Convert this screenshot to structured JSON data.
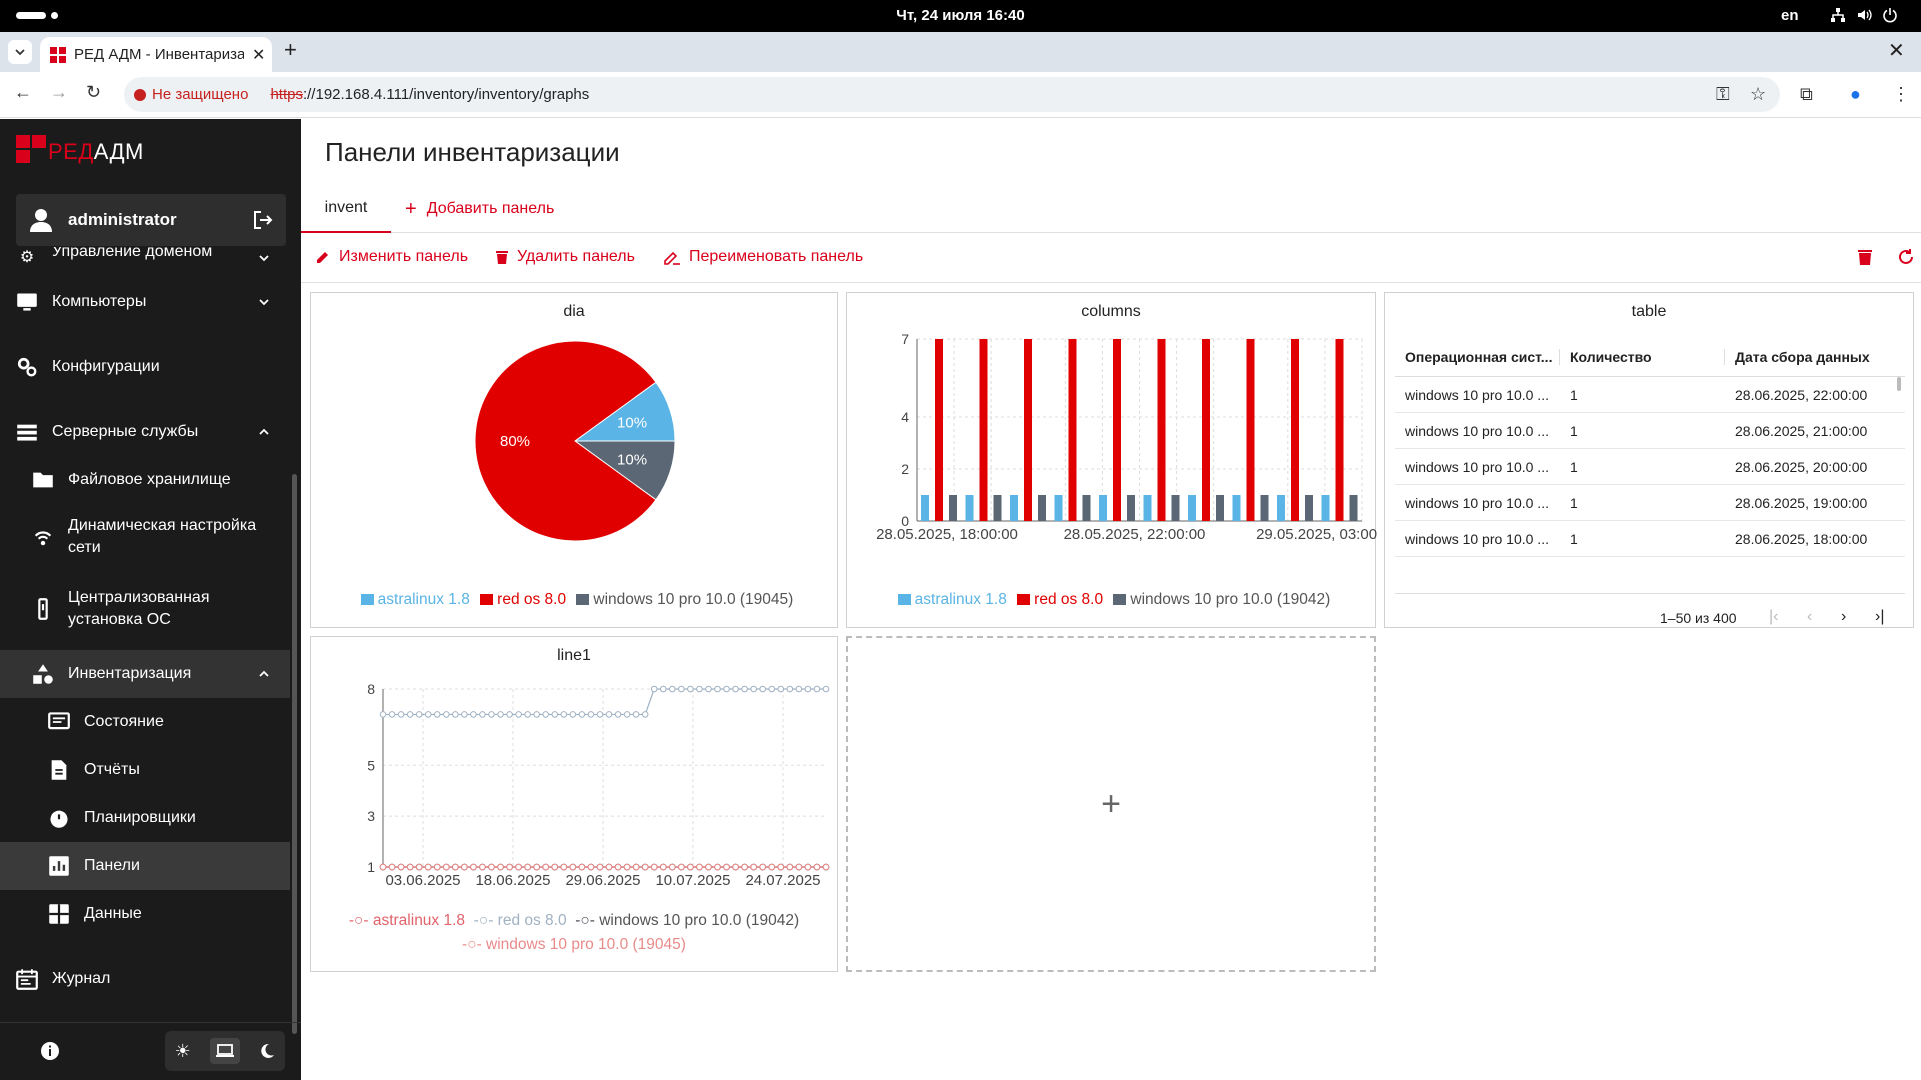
{
  "system": {
    "clock": "Чт, 24 июля  16:40",
    "lang": "en"
  },
  "browser": {
    "tab_title": "РЕД АДМ - Инвентаризация",
    "security_warning": "Не защищено",
    "url_scheme": "https",
    "url_rest": "://192.168.4.111/inventory/inventory/graphs"
  },
  "sidebar": {
    "logo_red": "РЕД",
    "logo_white": "АДМ",
    "user": "administrator",
    "items": [
      {
        "label": "Управление доменом"
      },
      {
        "label": "Компьютеры"
      },
      {
        "label": "Конфигурации"
      },
      {
        "label": "Серверные службы"
      },
      {
        "label": "Файловое хранилище"
      },
      {
        "label": "Динамическая настройка сети"
      },
      {
        "label": "Централизованная установка ОС"
      },
      {
        "label": "Инвентаризация"
      },
      {
        "label": "Состояние"
      },
      {
        "label": "Отчёты"
      },
      {
        "label": "Планировщики"
      },
      {
        "label": "Панели"
      },
      {
        "label": "Данные"
      },
      {
        "label": "Журнал"
      }
    ]
  },
  "main": {
    "title": "Панели инвентаризации",
    "tabs": [
      {
        "label": "invent"
      },
      {
        "label": "Добавить панель"
      }
    ],
    "actions": {
      "edit": "Изменить панель",
      "delete": "Удалить панель",
      "rename": "Переименовать панель"
    }
  },
  "colors": {
    "astralinux": "#5ab4e5",
    "redos": "#e00000",
    "windows": "#5b6775",
    "accent": "#d9001b"
  },
  "chart_data": [
    {
      "type": "pie",
      "title": "dia",
      "slices": [
        {
          "name": "astralinux 1.8",
          "value": 10,
          "label": "10%"
        },
        {
          "name": "red os 8.0",
          "value": 80,
          "label": "80%"
        },
        {
          "name": "windows 10 pro 10.0 (19045)",
          "value": 10,
          "label": "10%"
        }
      ]
    },
    {
      "type": "bar",
      "title": "columns",
      "ylim": [
        0,
        7
      ],
      "yticks": [
        0,
        2,
        4,
        7
      ],
      "xtick_labels": [
        "28.05.2025, 18:00:00",
        "28.05.2025, 22:00:00",
        "29.05.2025, 03:00:00"
      ],
      "groups": 10,
      "series": [
        {
          "name": "astralinux 1.8",
          "values": [
            1,
            1,
            1,
            1,
            1,
            1,
            1,
            1,
            1,
            1
          ]
        },
        {
          "name": "red os 8.0",
          "values": [
            7,
            7,
            7,
            7,
            7,
            7,
            7,
            7,
            7,
            7
          ]
        },
        {
          "name": "windows 10 pro 10.0 (19042)",
          "values": [
            1,
            1,
            1,
            1,
            1,
            1,
            1,
            1,
            1,
            1
          ]
        }
      ]
    },
    {
      "type": "line",
      "title": "line1",
      "ylim": [
        1,
        8
      ],
      "yticks": [
        1,
        3,
        5,
        8
      ],
      "xtick_labels": [
        "03.06.2025",
        "18.06.2025",
        "29.06.2025",
        "10.07.2025",
        "24.07.2025"
      ],
      "points": 50,
      "series": [
        {
          "name": "astralinux 1.8",
          "color": "#e0636a",
          "segments": [
            [
              0,
              49,
              1
            ]
          ]
        },
        {
          "name": "red os 8.0",
          "color": "#9fb1c2",
          "segments": [
            [
              0,
              29,
              7
            ],
            [
              30,
              49,
              8
            ]
          ]
        },
        {
          "name": "windows 10 pro 10.0 (19042)",
          "color": "#4a4f57",
          "segments": [
            [
              0,
              49,
              1
            ]
          ]
        },
        {
          "name": "windows 10 pro 10.0 (19045)",
          "color": "#e88a8a",
          "segments": [
            [
              0,
              49,
              1
            ]
          ]
        }
      ]
    }
  ],
  "table_panel": {
    "title": "table",
    "columns": [
      "Операционная сист...",
      "Количество",
      "Дата сбора данных"
    ],
    "rows": [
      [
        "windows 10 pro 10.0 ...",
        "1",
        "28.06.2025, 22:00:00"
      ],
      [
        "windows 10 pro 10.0 ...",
        "1",
        "28.06.2025, 21:00:00"
      ],
      [
        "windows 10 pro 10.0 ...",
        "1",
        "28.06.2025, 20:00:00"
      ],
      [
        "windows 10 pro 10.0 ...",
        "1",
        "28.06.2025, 19:00:00"
      ],
      [
        "windows 10 pro 10.0 ...",
        "1",
        "28.06.2025, 18:00:00"
      ]
    ],
    "range": "1–50 из 400"
  }
}
